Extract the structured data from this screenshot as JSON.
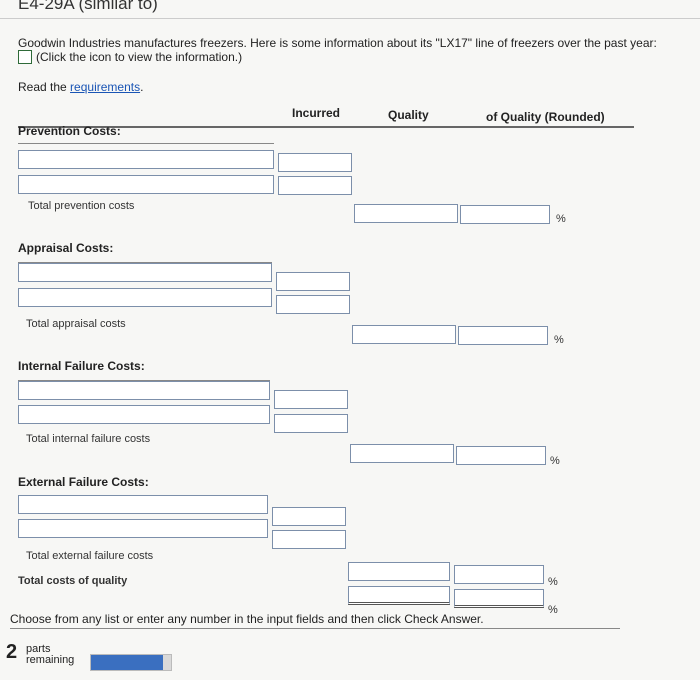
{
  "title": "E4-29A (similar to)",
  "intro": "Goodwin Industries manufactures freezers. Here is some information about its \"LX17\" line of freezers over the past year:",
  "click_text": "(Click the icon to view the information.)",
  "read_prefix": "Read the ",
  "requirements_link": "requirements",
  "read_suffix": ".",
  "headers": {
    "incurred": "Incurred",
    "quality": "Quality",
    "rounded": "of Quality (Rounded)"
  },
  "sections": {
    "prevention": {
      "title": "Prevention Costs:",
      "total": "Total prevention costs"
    },
    "appraisal": {
      "title": "Appraisal Costs:",
      "total": "Total appraisal costs"
    },
    "internal": {
      "title": "Internal Failure Costs:",
      "total": "Total internal failure costs"
    },
    "external": {
      "title": "External Failure Costs:",
      "total": "Total external failure costs"
    }
  },
  "total_quality_label": "Total costs of quality",
  "percent_symbol": "%",
  "footer": "Choose from any list or enter any number in the input fields and then click Check Answer.",
  "parts": {
    "count": "2",
    "label_line1": "parts",
    "label_line2": "remaining",
    "progress_fraction": 0.9
  }
}
